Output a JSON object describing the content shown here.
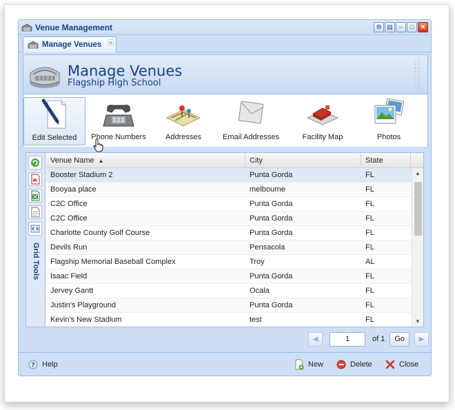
{
  "window": {
    "title": "Venue Management"
  },
  "tab": {
    "label": "Manage Venues"
  },
  "header": {
    "title": "Manage Venues",
    "subtitle": "Flagship High School"
  },
  "toolbar": {
    "items": [
      {
        "label": "Edit Selected",
        "icon": "edit-document-icon"
      },
      {
        "label": "Phone Numbers",
        "icon": "telephone-icon"
      },
      {
        "label": "Addresses",
        "icon": "map-icon"
      },
      {
        "label": "Email Addresses",
        "icon": "envelope-icon"
      },
      {
        "label": "Facility Map",
        "icon": "facility-map-icon"
      },
      {
        "label": "Photos",
        "icon": "photos-icon"
      }
    ]
  },
  "grid_tools": {
    "label": "Grid Tools",
    "icons": [
      "refresh-icon",
      "pdf-export-icon",
      "excel-export-icon",
      "document-icon",
      "code-icon"
    ]
  },
  "grid": {
    "columns": [
      "Venue Name",
      "City",
      "State"
    ],
    "sort_column": "Venue Name",
    "sort_direction": "ascending",
    "rows": [
      {
        "name": "Booster Stadium 2",
        "city": "Punta Gorda",
        "state": "FL"
      },
      {
        "name": "Booyaa place",
        "city": "melbourne",
        "state": "FL"
      },
      {
        "name": "C2C Office",
        "city": "Punta Gorda",
        "state": "FL"
      },
      {
        "name": "C2C Office",
        "city": "Punta Gorda",
        "state": "FL"
      },
      {
        "name": "Charlotte County Golf Course",
        "city": "Punta Gorda",
        "state": "FL"
      },
      {
        "name": "Devils Run",
        "city": "Pensacola",
        "state": "FL"
      },
      {
        "name": "Flagship Memorial Baseball Complex",
        "city": "Troy",
        "state": "AL"
      },
      {
        "name": "Isaac Field",
        "city": "Punta Gorda",
        "state": "FL"
      },
      {
        "name": "Jervey Gantt",
        "city": "Ocala",
        "state": "FL"
      },
      {
        "name": "Justin's Playground",
        "city": "Punta Gorda",
        "state": "FL"
      },
      {
        "name": "Kevin's New Stadium",
        "city": "test",
        "state": "FL"
      }
    ]
  },
  "pager": {
    "page": "1",
    "of_label": "of 1",
    "go_label": "Go"
  },
  "footer": {
    "help_label": "Help",
    "new_label": "New",
    "delete_label": "Delete",
    "close_label": "Close"
  },
  "colors": {
    "accent": "#15428b",
    "panel": "#cedff5",
    "border": "#99bbe8",
    "selected_row": "#dfe8f6"
  }
}
